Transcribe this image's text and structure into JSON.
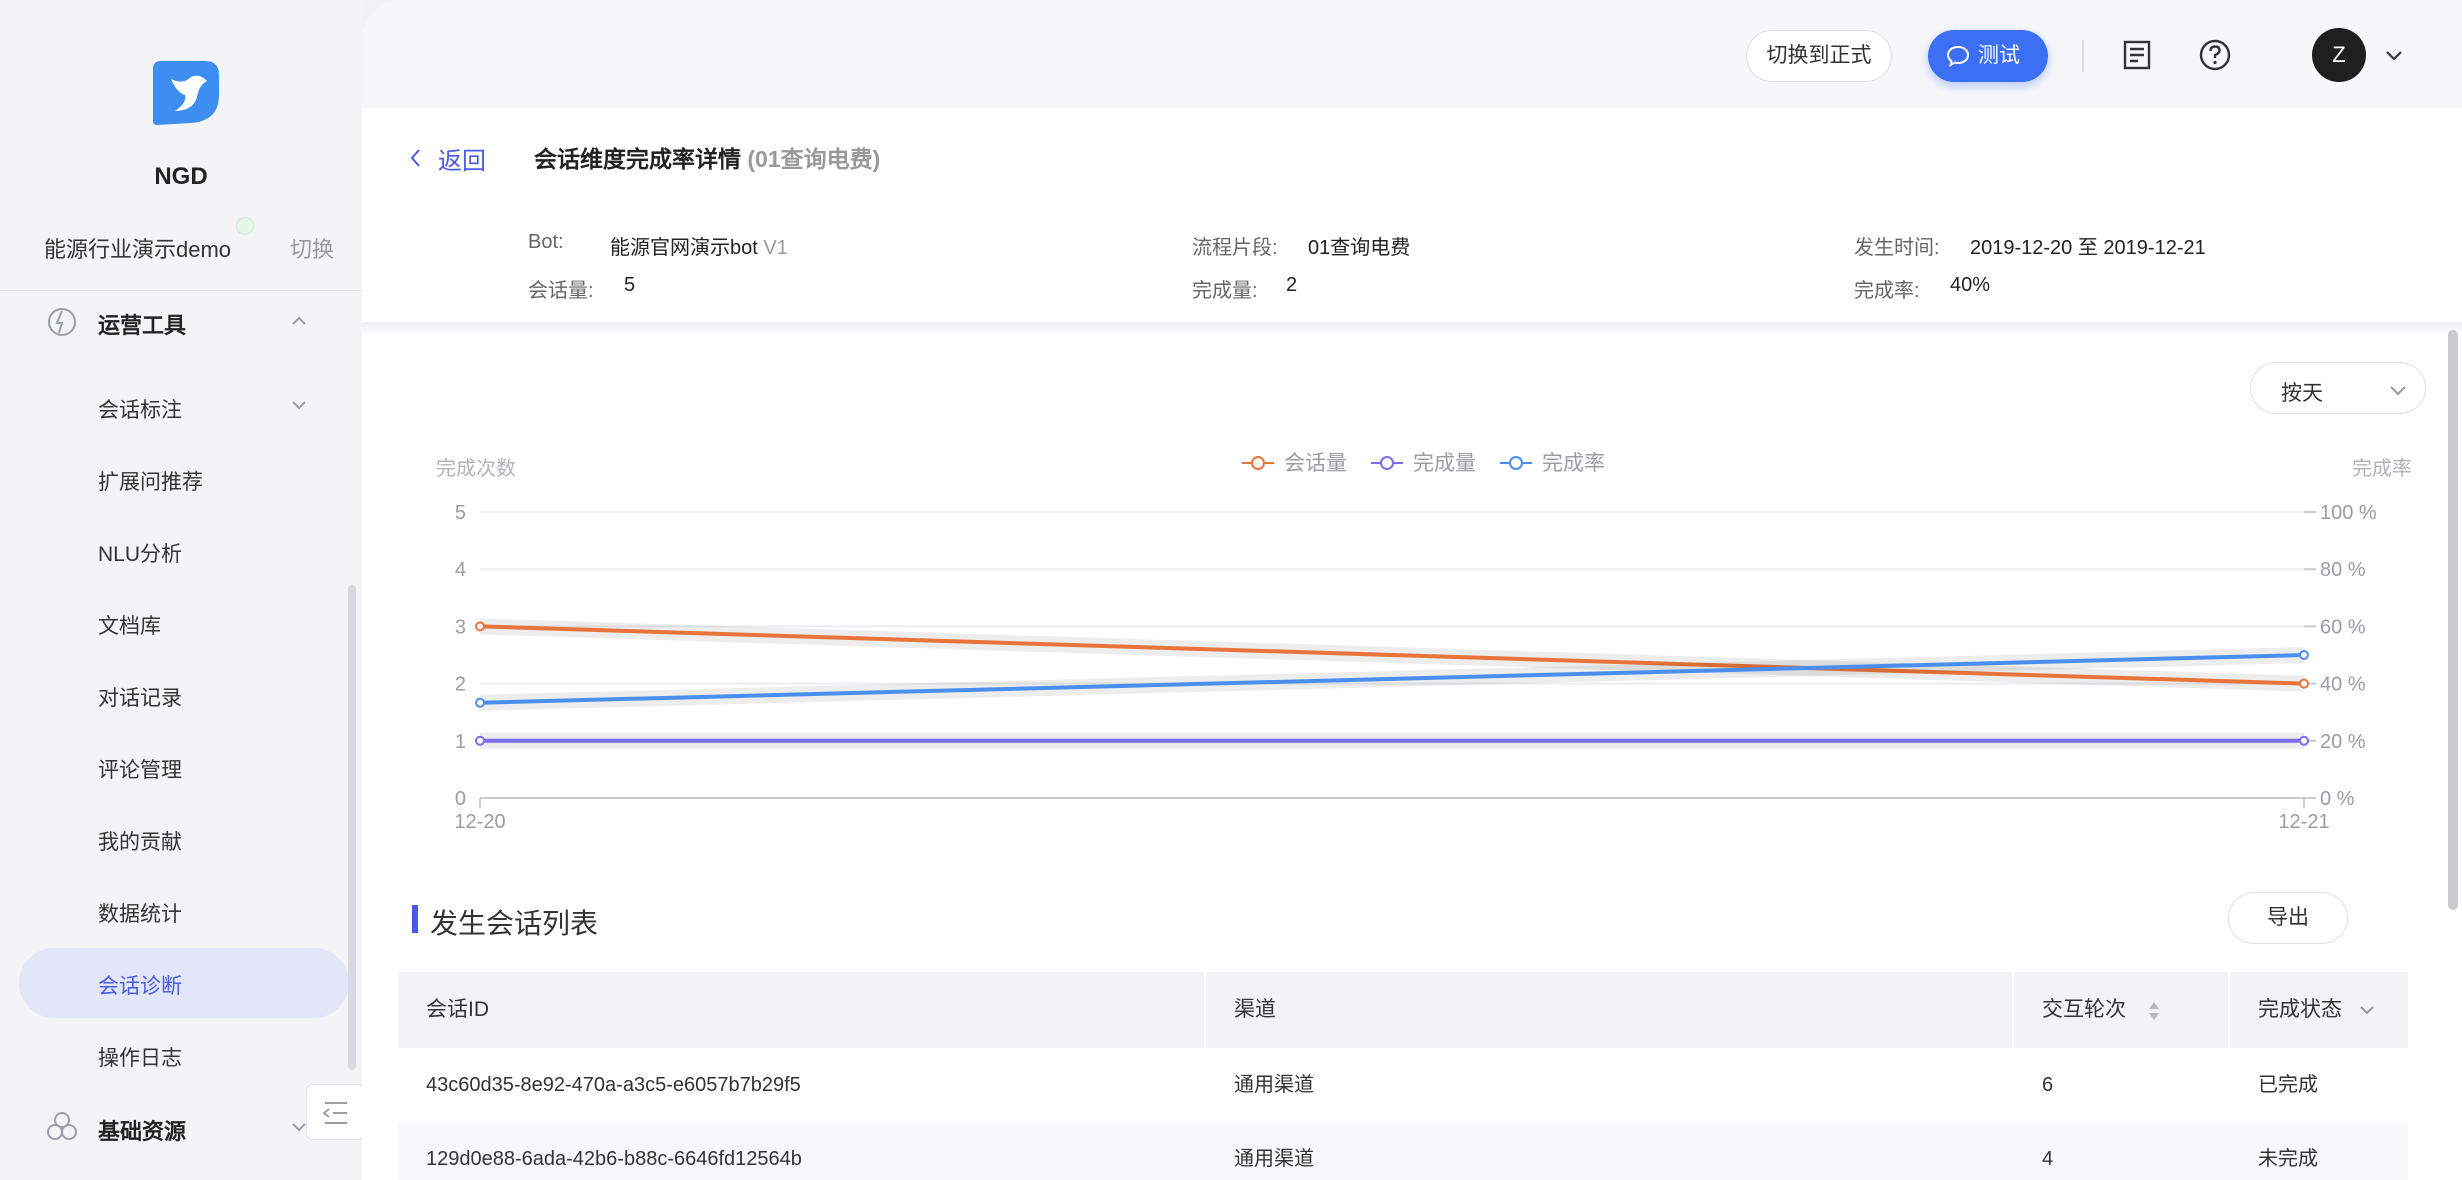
{
  "sidebar": {
    "brand": "NGD",
    "workspace": "能源行业演示demo",
    "switch_label": "切换",
    "groups": [
      {
        "label": "运营工具"
      },
      {
        "label": "基础资源"
      }
    ],
    "items": [
      {
        "label": "会话标注"
      },
      {
        "label": "扩展问推荐"
      },
      {
        "label": "NLU分析"
      },
      {
        "label": "文档库"
      },
      {
        "label": "对话记录"
      },
      {
        "label": "评论管理"
      },
      {
        "label": "我的贡献"
      },
      {
        "label": "数据统计"
      },
      {
        "label": "会话诊断"
      },
      {
        "label": "操作日志"
      }
    ],
    "active_item": "会话诊断"
  },
  "topbar": {
    "switch_label": "切换到正式",
    "test_label": "测试",
    "avatar_letter": "Z"
  },
  "header": {
    "back_label": "返回",
    "title": "会话维度完成率详情",
    "subtitle": "(01查询电费)"
  },
  "info": {
    "bot_label": "Bot:",
    "bot_value": "能源官网演示bot",
    "bot_version": "V1",
    "segment_label": "流程片段:",
    "segment_value": "01查询电费",
    "time_label": "发生时间:",
    "time_value": "2019-12-20 至 2019-12-21",
    "sessions_label": "会话量:",
    "sessions_value": "5",
    "completed_label": "完成量:",
    "completed_value": "2",
    "rate_label": "完成率:",
    "rate_value": "40%"
  },
  "granularity_select": "按天",
  "chart_data": {
    "type": "line",
    "x": [
      "12-20",
      "12-21"
    ],
    "ylabel": "完成次数",
    "ylabel_right": "完成率",
    "y_ticks": [
      "0",
      "1",
      "2",
      "3",
      "4",
      "5"
    ],
    "y_right_ticks": [
      "0 %",
      "20 %",
      "40 %",
      "60 %",
      "80 %",
      "100 %"
    ],
    "ylim": [
      0,
      5
    ],
    "ylim_right": [
      0,
      100
    ],
    "legend_position": "top-center",
    "grid": true,
    "series": [
      {
        "name": "会话量",
        "axis": "left",
        "values": [
          3,
          2
        ],
        "color": "#e8743b"
      },
      {
        "name": "完成量",
        "axis": "left",
        "values": [
          1,
          1
        ],
        "color": "#7b6cf0"
      },
      {
        "name": "完成率",
        "axis": "right",
        "values": [
          33.3,
          50
        ],
        "color": "#4a8ff0"
      }
    ]
  },
  "list": {
    "title": "发生会话列表",
    "export_label": "导出",
    "columns": [
      "会话ID",
      "渠道",
      "交互轮次",
      "完成状态"
    ],
    "rows": [
      [
        "43c60d35-8e92-470a-a3c5-e6057b7b29f5",
        "通用渠道",
        "6",
        "已完成"
      ],
      [
        "129d0e88-6ada-42b6-b88c-6646fd12564b",
        "通用渠道",
        "4",
        "未完成"
      ]
    ]
  },
  "colors": {
    "accent": "#4a5ae8",
    "test_button": "#3d6ff5",
    "active_menu_bg": "#e3e6f8"
  }
}
